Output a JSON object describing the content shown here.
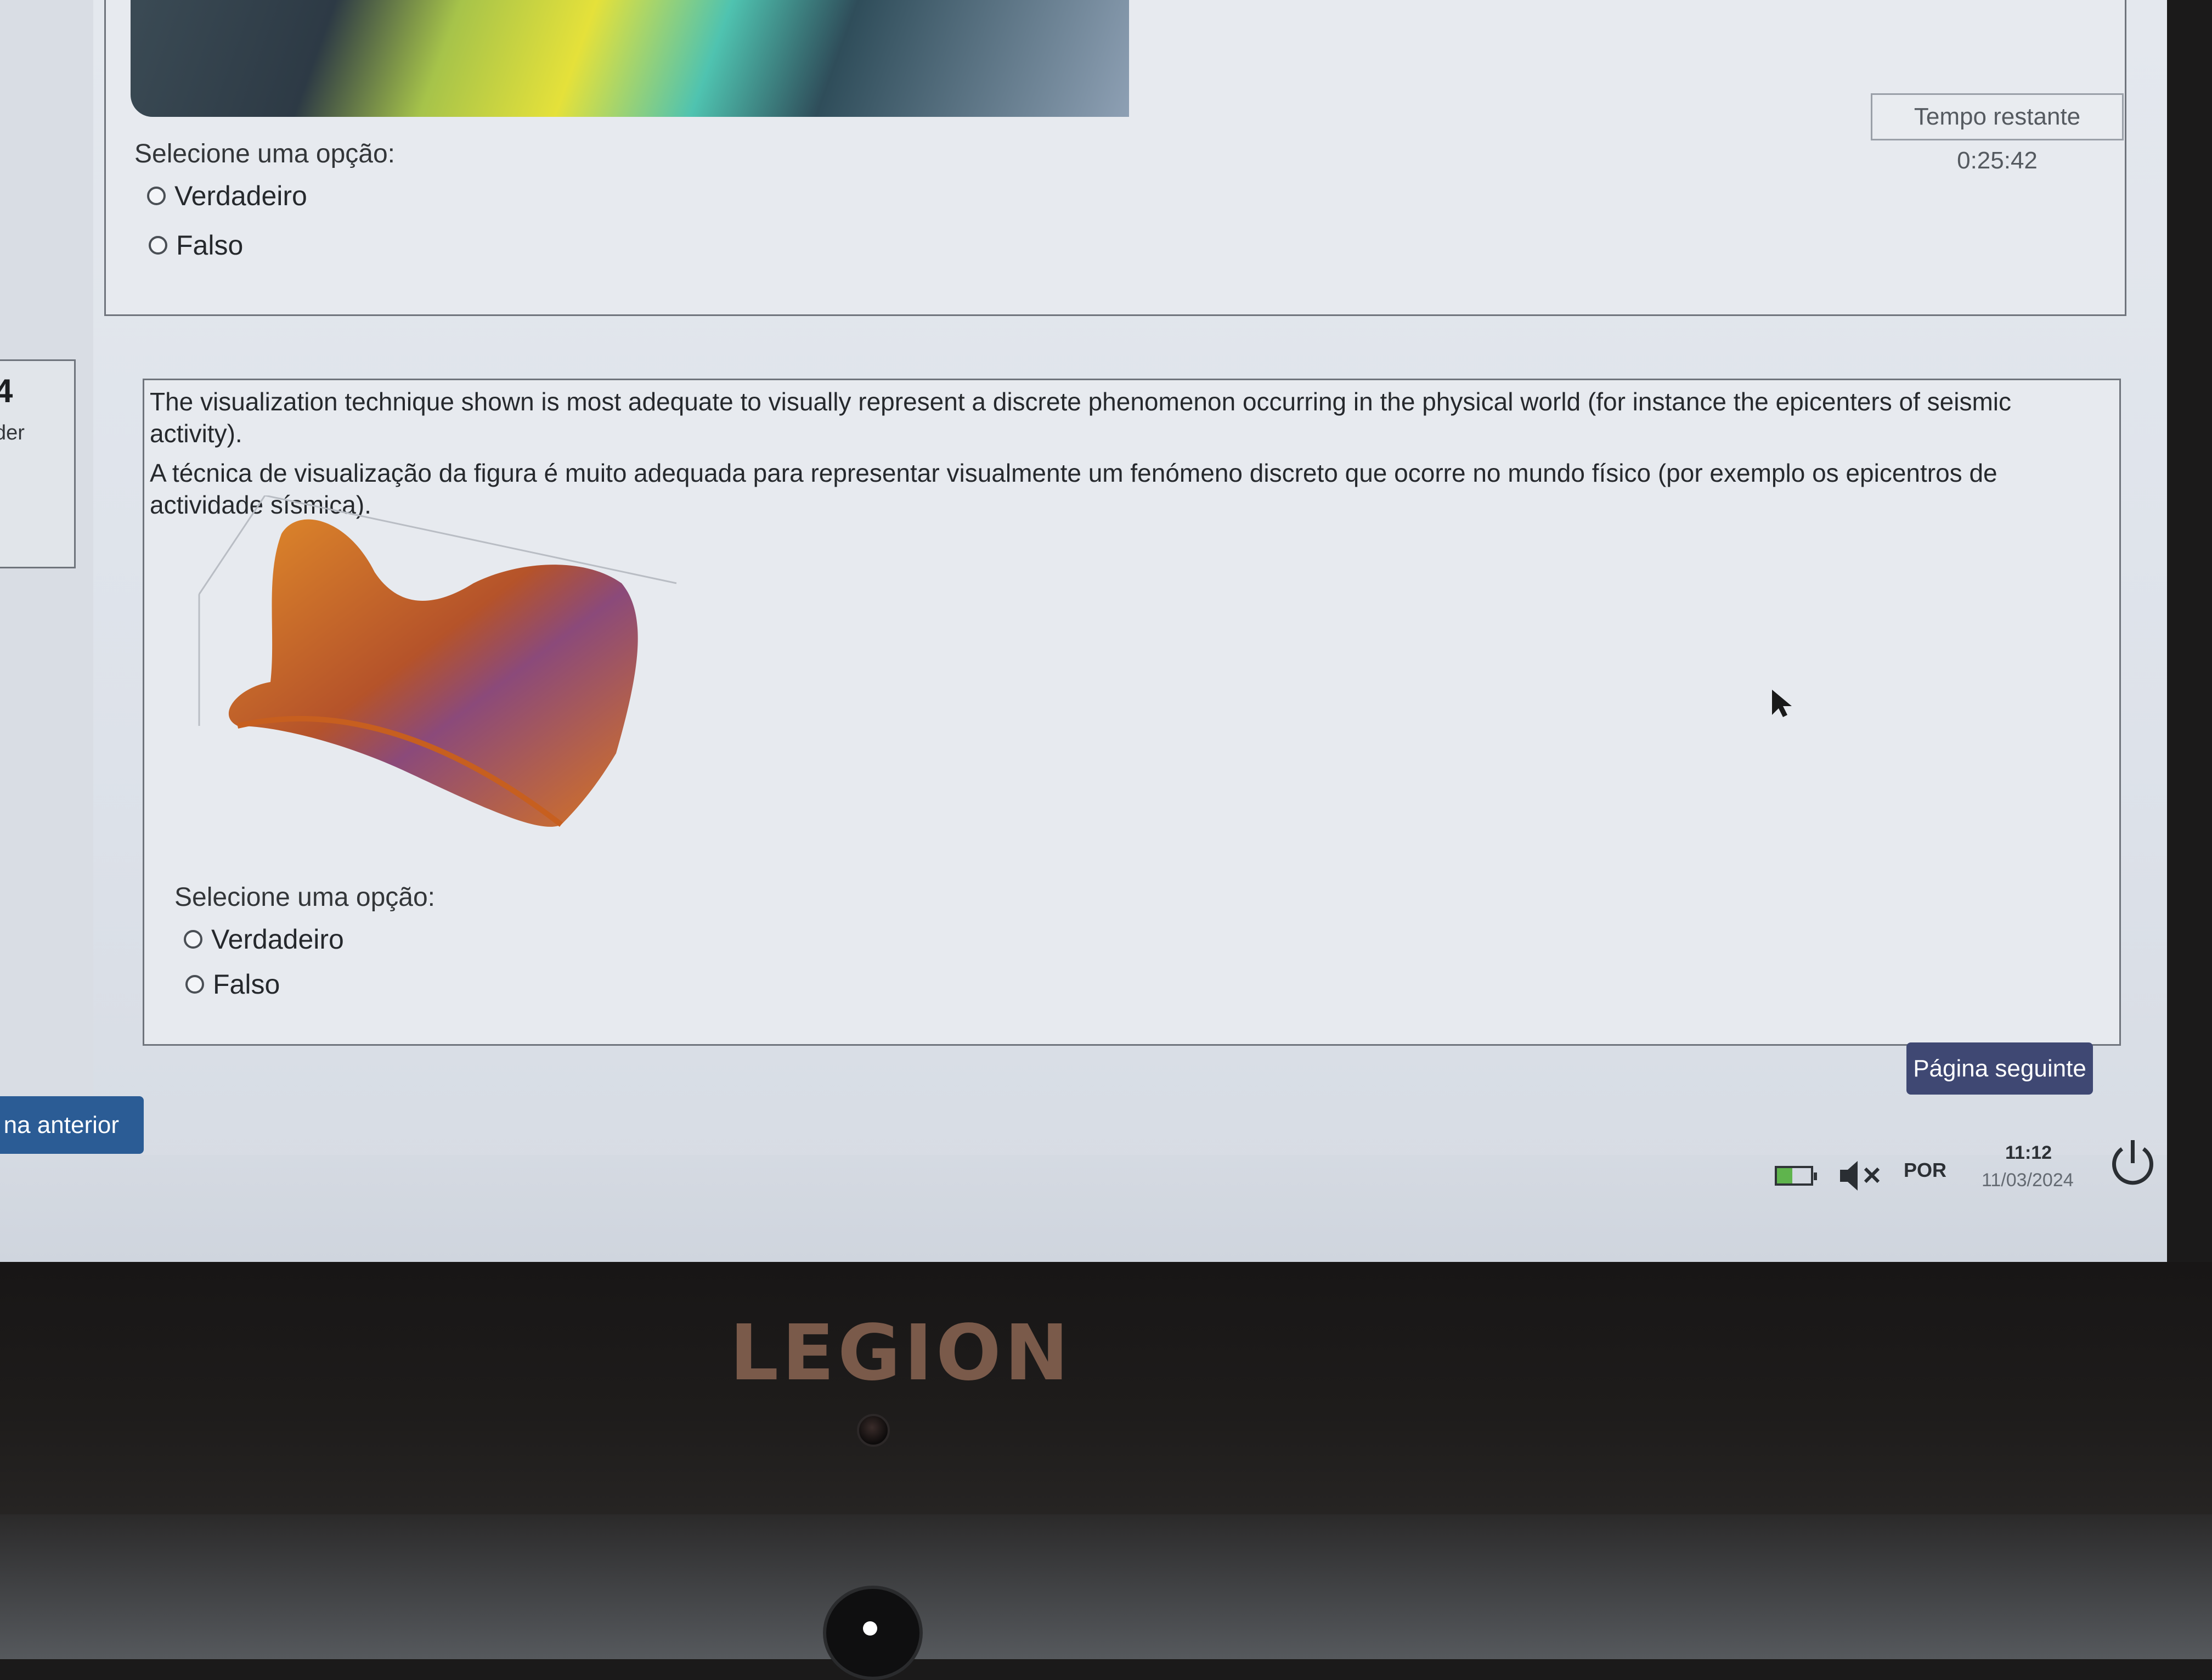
{
  "timer": {
    "text": "Tempo restante 0:25:42"
  },
  "previous_question": {
    "select_label": "Selecione uma opção:",
    "options": [
      {
        "label": "Verdadeiro"
      },
      {
        "label": "Falso"
      }
    ]
  },
  "current_question": {
    "number": "4",
    "sidebar_sub": "der",
    "text_en": "The visualization technique shown is most adequate to visually represent a discrete phenomenon occurring in the physical world (for instance the epicenters of seismic activity).",
    "text_pt": "A técnica de visualização da figura é muito adequada para representar visualmente um fenómeno discreto que ocorre no mundo físico (por exemplo os epicentros de actividade sísmica).",
    "select_label": "Selecione uma opção:",
    "options": [
      {
        "label": "Verdadeiro"
      },
      {
        "label": "Falso"
      }
    ],
    "figure_icon": "3d-surface-plot"
  },
  "navigation": {
    "next_label": "Página seguinte",
    "prev_label": "na anterior"
  },
  "taskbar": {
    "language": "POR",
    "time": "11:12",
    "date": "11/03/2024",
    "battery_icon": "battery-icon",
    "volume_icon": "volume-muted-icon",
    "power_icon": "power-icon"
  },
  "bezel": {
    "logo_text": "LEGION"
  },
  "colors": {
    "next_button": "#3f4873",
    "prev_button": "#2b5c95",
    "surface_orange": "#d9751e"
  }
}
